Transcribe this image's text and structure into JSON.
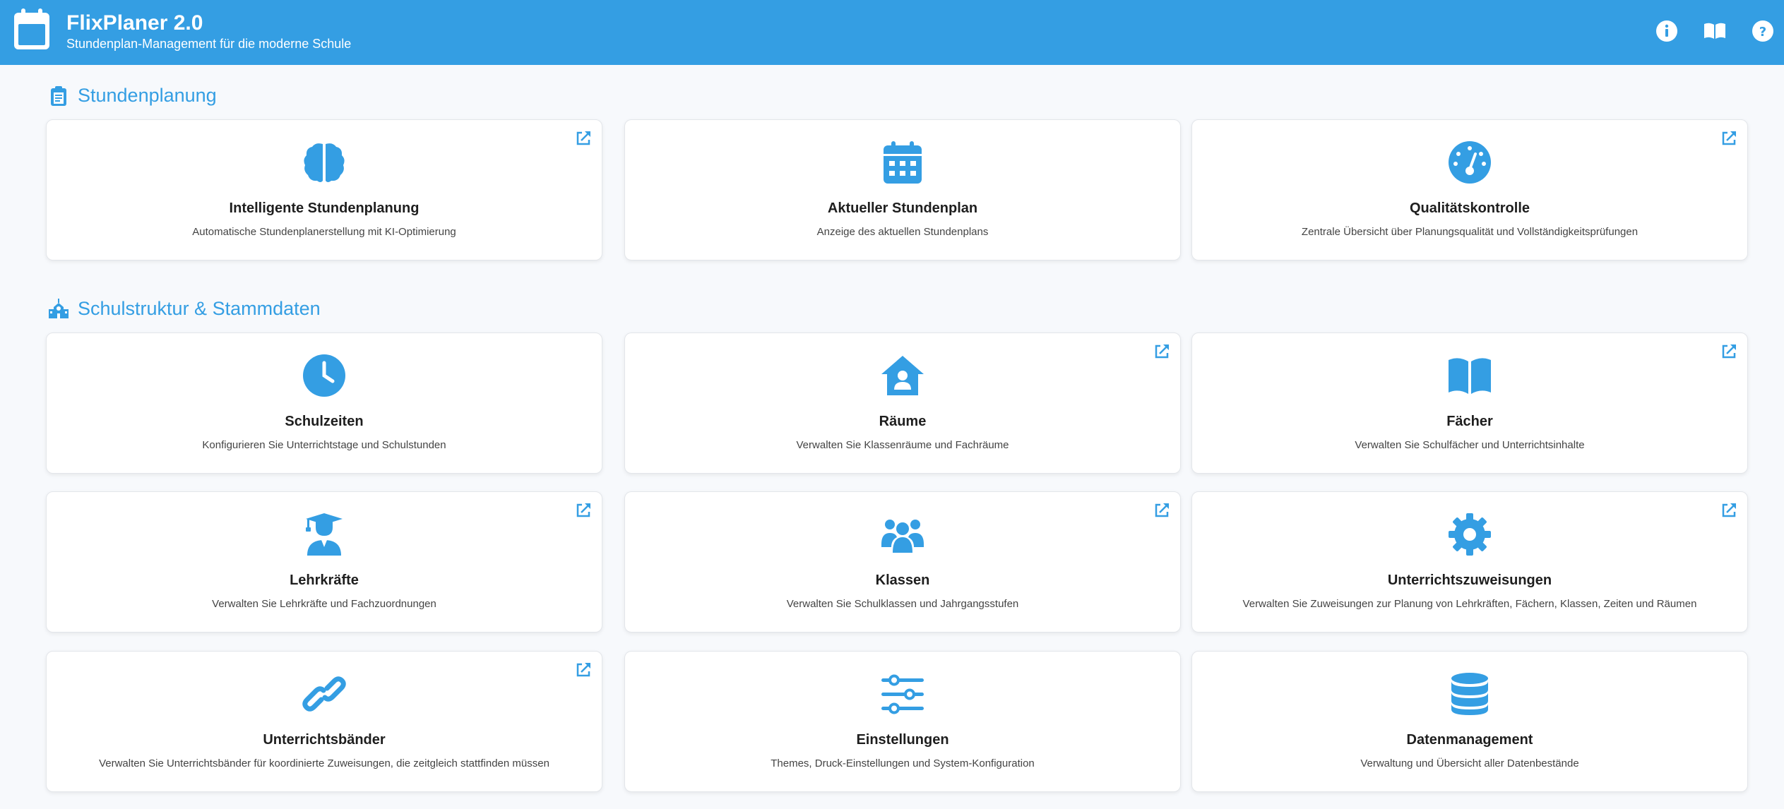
{
  "header": {
    "title": "FlixPlaner 2.0",
    "subtitle": "Stundenplan-Management für die moderne Schule",
    "icons": [
      "info-icon",
      "book-icon",
      "help-icon"
    ]
  },
  "accent_color": "#349ee3",
  "sections": [
    {
      "title": "Stundenplanung",
      "icon": "clipboard-icon",
      "cards": [
        {
          "title": "Intelligente Stundenplanung",
          "desc": "Automatische Stundenplanerstellung mit KI-Optimierung",
          "icon": "brain-icon",
          "external": true
        },
        {
          "title": "Aktueller Stundenplan",
          "desc": "Anzeige des aktuellen Stundenplans",
          "icon": "calendar-icon",
          "external": false
        },
        {
          "title": "Qualitätskontrolle",
          "desc": "Zentrale Übersicht über Planungsqualität und Vollständigkeitsprüfungen",
          "icon": "gauge-icon",
          "external": true
        }
      ]
    },
    {
      "title": "Schulstruktur & Stammdaten",
      "icon": "school-icon",
      "cards": [
        {
          "title": "Schulzeiten",
          "desc": "Konfigurieren Sie Unterrichtstage und Schulstunden",
          "icon": "clock-icon",
          "external": false
        },
        {
          "title": "Räume",
          "desc": "Verwalten Sie Klassenräume und Fachräume",
          "icon": "house-user-icon",
          "external": true
        },
        {
          "title": "Fächer",
          "desc": "Verwalten Sie Schulfächer und Unterrichtsinhalte",
          "icon": "open-book-icon",
          "external": true
        },
        {
          "title": "Lehrkräfte",
          "desc": "Verwalten Sie Lehrkräfte und Fachzuordnungen",
          "icon": "teacher-icon",
          "external": true
        },
        {
          "title": "Klassen",
          "desc": "Verwalten Sie Schulklassen und Jahrgangsstufen",
          "icon": "users-icon",
          "external": true
        },
        {
          "title": "Unterrichtszuweisungen",
          "desc": "Verwalten Sie Zuweisungen zur Planung von Lehrkräften, Fächern, Klassen, Zeiten und Räumen",
          "icon": "gear-icon",
          "external": true
        },
        {
          "title": "Unterrichtsbänder",
          "desc": "Verwalten Sie Unterrichtsbänder für koordinierte Zuweisungen, die zeitgleich stattfinden müssen",
          "icon": "link-icon",
          "external": true
        },
        {
          "title": "Einstellungen",
          "desc": "Themes, Druck-Einstellungen und System-Konfiguration",
          "icon": "sliders-icon",
          "external": false
        },
        {
          "title": "Datenmanagement",
          "desc": "Verwaltung und Übersicht aller Datenbestände",
          "icon": "database-icon",
          "external": false
        }
      ]
    }
  ]
}
